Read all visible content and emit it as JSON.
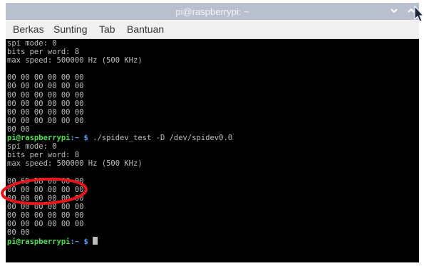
{
  "window": {
    "title": "pi@raspberrypi: ~",
    "minimize_glyph": "⌄",
    "maximize_glyph": "⌃"
  },
  "menu": {
    "items": [
      "Berkas",
      "Sunting",
      "Tab",
      "Bantuan"
    ]
  },
  "terminal": {
    "lines": [
      {
        "text": "spi mode: 0"
      },
      {
        "text": "bits per word: 8"
      },
      {
        "text": "max speed: 500000 Hz (500 KHz)"
      },
      {
        "text": ""
      },
      {
        "text": "00 00 00 00 00 00"
      },
      {
        "text": "00 00 00 00 00 00"
      },
      {
        "text": "00 00 00 00 00 00"
      },
      {
        "text": "00 00 00 00 00 00"
      },
      {
        "text": "00 00 00 00 00 00"
      },
      {
        "text": "00 00 00 00 00 00"
      },
      {
        "text": "00 00"
      },
      {
        "user": "pi@raspberrypi",
        "path": ":~ $ ",
        "cmd": "./spidev_test -D /dev/spidev0.0"
      },
      {
        "text": "spi mode: 0"
      },
      {
        "text": "bits per word: 8"
      },
      {
        "text": "max speed: 500000 Hz (500 KHz)"
      },
      {
        "text": ""
      },
      {
        "text": "00 6D DB 00 00 00"
      },
      {
        "text": "00 00 00 00 00 00"
      },
      {
        "text": "00 00 00 00 00 00"
      },
      {
        "text": "00 00 00 00 00 00"
      },
      {
        "text": "00 00 00 00 00 00"
      },
      {
        "text": "00 00 00 00 00 00"
      },
      {
        "text": "00 00"
      },
      {
        "user": "pi@raspberrypi",
        "path": ":~ $ ",
        "cmd": "",
        "cursor": true
      }
    ]
  },
  "colors": {
    "titlebar_bg": "#b8bfcd",
    "terminal_bg": "#000000",
    "terminal_fg": "#bdbdbd",
    "prompt_user": "#4fe04f",
    "prompt_path": "#5aa0ff",
    "annotation": "#e8161b"
  }
}
